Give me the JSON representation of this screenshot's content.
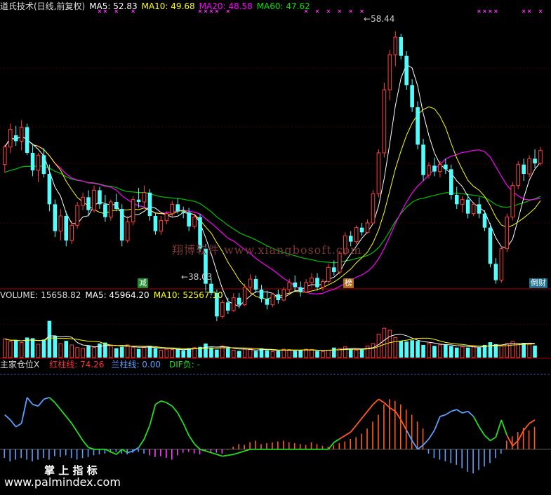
{
  "legend_price": {
    "name": "道氏技术(日线,前复权)",
    "ma5": "MA5: 52.83",
    "ma10": "MA10: 49.68",
    "ma20": "MA20: 48.58",
    "ma60": "MA60: 47.62"
  },
  "legend_volume": {
    "name": "VOLUME: 15658.82",
    "ma5": "MA5: 45964.20",
    "ma10": "MA10: 52567.10"
  },
  "legend_indicator": {
    "name": "主家仓位X",
    "red": "红柱线: 74.26",
    "blue": "兰柱线: 0.00",
    "dif": "DIF负: -"
  },
  "annotations": {
    "high": "58.44",
    "low": "38.03",
    "tag1": "减",
    "tag2": "榜",
    "tag3": "倒财"
  },
  "watermark": {
    "site1": "翔博软件 www.xiangbosoft.com",
    "brand2": "掌 上 指 标",
    "site2": "www.palmindex.com"
  },
  "colors": {
    "up": "#ff4040",
    "down": "#54fcfc",
    "ma5": "#ffffff",
    "ma10": "#ffff00",
    "ma20": "#ff00ff",
    "ma60": "#00c000",
    "indicator_green": "#22dd22",
    "indicator_orange": "#ff5c1c",
    "indicator_blue": "#5aa0ff",
    "indicator_magenta": "#ff40ff",
    "grid": "#8a0000"
  },
  "chart_data": {
    "type": "candlestick",
    "price_range": [
      37.5,
      60
    ],
    "candles": [
      [
        47,
        48.7,
        46.3,
        48.5
      ],
      [
        48.5,
        50.5,
        48,
        50
      ],
      [
        49.5,
        50.3,
        48.6,
        49
      ],
      [
        49,
        50.8,
        48.2,
        50.2
      ],
      [
        50.2,
        50.5,
        47.8,
        48
      ],
      [
        48,
        48.8,
        46,
        46.5
      ],
      [
        46.5,
        48,
        45.5,
        47.8
      ],
      [
        47.8,
        48.4,
        45.9,
        46.2
      ],
      [
        46.2,
        47,
        43,
        43.6
      ],
      [
        43.6,
        44,
        40.8,
        41.3
      ],
      [
        41.3,
        43.2,
        40.5,
        42.6
      ],
      [
        42.6,
        43,
        40,
        40.5
      ],
      [
        40.5,
        42.2,
        40.2,
        41.8
      ],
      [
        41.8,
        43.8,
        41.5,
        43.5
      ],
      [
        43.5,
        44.6,
        43.1,
        44.2
      ],
      [
        44.2,
        44.8,
        42.6,
        43.1
      ],
      [
        43.1,
        45.2,
        42.9,
        44.8
      ],
      [
        44.8,
        45.1,
        43.2,
        43.6
      ],
      [
        43.6,
        44.4,
        42.1,
        42.5
      ],
      [
        42.5,
        44,
        42.2,
        43.8
      ],
      [
        43.8,
        44.5,
        43,
        43.2
      ],
      [
        43.2,
        43.6,
        40,
        40.5
      ],
      [
        40.5,
        42.6,
        40.3,
        42.1
      ],
      [
        42.1,
        44.3,
        41.8,
        44
      ],
      [
        44,
        45,
        43.3,
        43.8
      ],
      [
        43.8,
        45.2,
        43.4,
        44.6
      ],
      [
        44.6,
        44.9,
        42.2,
        42.6
      ],
      [
        42.6,
        42.9,
        41,
        41.3
      ],
      [
        41.3,
        42.6,
        41,
        42.2
      ],
      [
        42.2,
        43,
        41.9,
        42.8
      ],
      [
        42.8,
        43.9,
        42.5,
        43.6
      ],
      [
        43.6,
        44.1,
        42.8,
        43
      ],
      [
        43,
        43.4,
        42.4,
        42.9
      ],
      [
        42.9,
        43.3,
        41.3,
        41.7
      ],
      [
        41.7,
        42.8,
        41.5,
        42.5
      ],
      [
        42.5,
        42.8,
        39.5,
        39.8
      ],
      [
        39.8,
        40.2,
        36.2,
        36.8
      ],
      [
        36.8,
        37.2,
        35.8,
        36
      ],
      [
        36,
        36.3,
        33.6,
        34
      ],
      [
        34,
        35.4,
        33.8,
        35.2
      ],
      [
        35.2,
        35.6,
        34.2,
        34.5
      ],
      [
        34.5,
        36,
        34.4,
        35.6
      ],
      [
        35.6,
        36,
        34.7,
        35
      ],
      [
        35,
        36.8,
        34.9,
        36.5
      ],
      [
        36.5,
        37.6,
        35.9,
        37.2
      ],
      [
        37.2,
        37.5,
        36,
        36.3
      ],
      [
        36.3,
        36.7,
        35.2,
        35.5
      ],
      [
        35.5,
        36.2,
        34.6,
        35
      ],
      [
        35,
        36,
        34.8,
        35.9
      ],
      [
        35.9,
        36.3,
        35.1,
        35.4
      ],
      [
        35.4,
        36.5,
        35.3,
        36.3
      ],
      [
        36.3,
        37.2,
        36,
        36.9
      ],
      [
        36.9,
        37.5,
        36.2,
        36.5
      ],
      [
        36.5,
        37,
        35.7,
        36.1
      ],
      [
        36.1,
        37.2,
        36,
        36.9
      ],
      [
        36.9,
        37.7,
        36.5,
        37.3
      ],
      [
        37.3,
        37.7,
        36.2,
        36.5
      ],
      [
        36.5,
        37.2,
        36.2,
        37
      ],
      [
        37,
        38.5,
        36.8,
        38.2
      ],
      [
        38.2,
        38.8,
        37.5,
        37.8
      ],
      [
        37.8,
        39.6,
        37.6,
        39.4
      ],
      [
        39.4,
        41.2,
        39.2,
        40.9
      ],
      [
        40.9,
        41.3,
        40,
        40.4
      ],
      [
        40.4,
        41.8,
        40.2,
        41.6
      ],
      [
        41.6,
        42,
        40.9,
        41.2
      ],
      [
        41.2,
        42.3,
        41.1,
        42
      ],
      [
        42,
        44.8,
        41.9,
        44.5
      ],
      [
        44.5,
        48.3,
        44.2,
        48
      ],
      [
        48,
        54,
        47.6,
        53.4
      ],
      [
        53.4,
        56.8,
        52.5,
        56.4
      ],
      [
        56.4,
        58.4,
        55.4,
        57.9
      ],
      [
        57.9,
        58.2,
        56,
        56.3
      ],
      [
        56.3,
        56.7,
        53.4,
        53.8
      ],
      [
        53.8,
        54.3,
        51.5,
        51.9
      ],
      [
        51.9,
        52.4,
        48.3,
        48.7
      ],
      [
        48.7,
        49.2,
        45.6,
        46.1
      ],
      [
        46.1,
        47.2,
        45.8,
        46.9
      ],
      [
        46.9,
        47.6,
        46,
        46.4
      ],
      [
        46.4,
        47.3,
        45.9,
        47
      ],
      [
        47,
        47.5,
        46.2,
        46.6
      ],
      [
        46.6,
        47,
        44,
        44.4
      ],
      [
        44.4,
        45.1,
        43.2,
        43.6
      ],
      [
        43.6,
        44.3,
        42.9,
        44
      ],
      [
        44,
        44.5,
        42.4,
        42.8
      ],
      [
        42.8,
        43.8,
        42.6,
        43.6
      ],
      [
        43.6,
        44.2,
        42.4,
        42.8
      ],
      [
        42.8,
        43.1,
        41.3,
        41.6
      ],
      [
        41.6,
        42,
        38.2,
        38.5
      ],
      [
        38.5,
        39,
        36.8,
        37.1
      ],
      [
        37.1,
        40,
        36.9,
        39.8
      ],
      [
        39.8,
        42.8,
        39.5,
        42.5
      ],
      [
        42.5,
        45.5,
        42.2,
        45.2
      ],
      [
        45.2,
        47.3,
        44.9,
        47
      ],
      [
        47,
        47.5,
        45.6,
        46.2
      ],
      [
        46.2,
        47.8,
        45.9,
        47.5
      ],
      [
        47.5,
        48.3,
        46.7,
        47.1
      ],
      [
        47.1,
        48.5,
        46.9,
        48.2
      ]
    ],
    "volume_range": [
      0,
      168000
    ],
    "volume": [
      56000,
      48000,
      52000,
      45000,
      60000,
      58000,
      40000,
      54000,
      110000,
      65000,
      42000,
      50000,
      38000,
      30000,
      28000,
      35000,
      30000,
      42000,
      45000,
      35000,
      28000,
      32000,
      38000,
      30000,
      26000,
      30000,
      35000,
      28000,
      22000,
      25000,
      24000,
      26000,
      22000,
      28000,
      30000,
      32000,
      42000,
      30000,
      24000,
      35000,
      28000,
      22000,
      20000,
      25000,
      26000,
      20000,
      28000,
      22000,
      18000,
      20000,
      25000,
      24000,
      20000,
      22000,
      25000,
      24000,
      20000,
      18000,
      22000,
      30000,
      28000,
      32000,
      25000,
      22000,
      24000,
      35000,
      42000,
      70000,
      88000,
      82000,
      60000,
      50000,
      48000,
      52000,
      50000,
      38000,
      42000,
      35000,
      38000,
      40000,
      35000,
      30000,
      32000,
      30000,
      34000,
      30000,
      38000,
      46000,
      40000,
      35000,
      42000,
      48000,
      42000,
      44000,
      40000,
      36000
    ],
    "indicator_range": [
      -40,
      90
    ],
    "indicator_line": [
      40,
      34,
      26,
      30,
      60,
      52,
      50,
      58,
      60,
      54,
      46,
      38,
      30,
      20,
      10,
      2,
      0,
      0,
      0,
      -3,
      -6,
      0,
      -4,
      -2,
      2,
      12,
      28,
      52,
      56,
      54,
      50,
      42,
      30,
      16,
      6,
      0,
      -2,
      -4,
      -6,
      -8,
      -7,
      -6,
      -4,
      -2,
      0,
      0,
      0,
      0,
      0,
      0,
      0,
      0,
      0,
      0,
      0,
      0,
      0,
      0,
      0,
      8,
      12,
      16,
      20,
      28,
      36,
      44,
      52,
      58,
      54,
      48,
      44,
      34,
      22,
      10,
      0,
      5,
      12,
      22,
      38,
      40,
      44,
      46,
      42,
      44,
      38,
      26,
      16,
      10,
      14,
      34,
      16,
      4,
      10,
      22,
      30,
      34
    ],
    "indicator_bars": [
      -10,
      -14,
      -12,
      -10,
      -12,
      -14,
      -12,
      -10,
      -12,
      -8,
      -9,
      -7,
      -10,
      -12,
      -10,
      -9,
      -7,
      -6,
      -5,
      -4,
      -3,
      -5,
      -6,
      -4,
      -3,
      -5,
      -7,
      -9,
      -8,
      -10,
      -12,
      -7,
      -4,
      -3,
      -5,
      -6,
      -2,
      -3,
      -4,
      -5,
      0,
      3,
      6,
      5,
      8,
      10,
      6,
      7,
      8,
      9,
      10,
      8,
      7,
      6,
      5,
      8,
      6,
      4,
      3,
      5,
      7,
      9,
      12,
      14,
      18,
      24,
      32,
      40,
      52,
      58,
      56,
      52,
      46,
      40,
      32,
      24,
      -5,
      -10,
      -12,
      -14,
      -16,
      -18,
      -22,
      -26,
      -28,
      -24,
      -20,
      -16,
      -10,
      -5,
      10,
      15,
      20,
      25,
      22,
      26
    ]
  }
}
